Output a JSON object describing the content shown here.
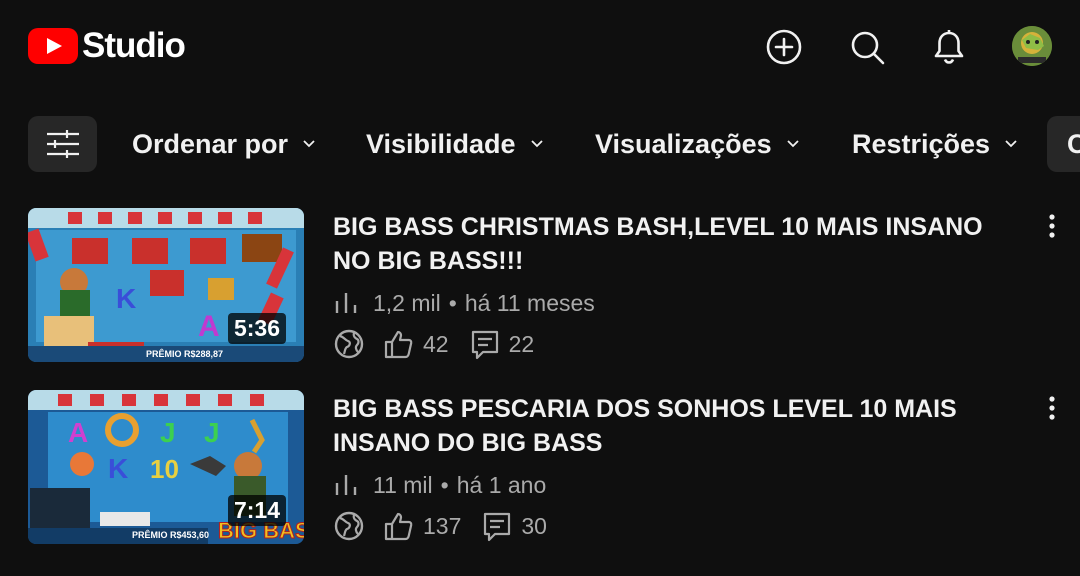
{
  "header": {
    "logo_text": "Studio",
    "icons": [
      "create-icon",
      "search-icon",
      "notifications-icon",
      "avatar"
    ],
    "accent_color": "#ff0000"
  },
  "filters": {
    "chips": [
      {
        "label": "Ordenar por"
      },
      {
        "label": "Visibilidade"
      },
      {
        "label": "Visualizações"
      },
      {
        "label": "Restrições"
      },
      {
        "label": "C"
      }
    ]
  },
  "videos": [
    {
      "title": "BIG BASS CHRISTMAS BASH,LEVEL 10 MAIS INSANO NO BIG BASS!!!",
      "duration": "5:36",
      "views": "1,2 mil",
      "separator": "•",
      "age": "há 11 meses",
      "likes": "42",
      "comments": "22",
      "thumb_text": "PRÊMIO R$288,87"
    },
    {
      "title": "BIG BASS PESCARIA DOS SONHOS LEVEL 10 MAIS INSANO DO BIG BASS",
      "duration": "7:14",
      "views": "11 mil",
      "separator": "•",
      "age": "há 1 ano",
      "likes": "137",
      "comments": "30",
      "thumb_text": "PRÊMIO R$453,60"
    }
  ]
}
